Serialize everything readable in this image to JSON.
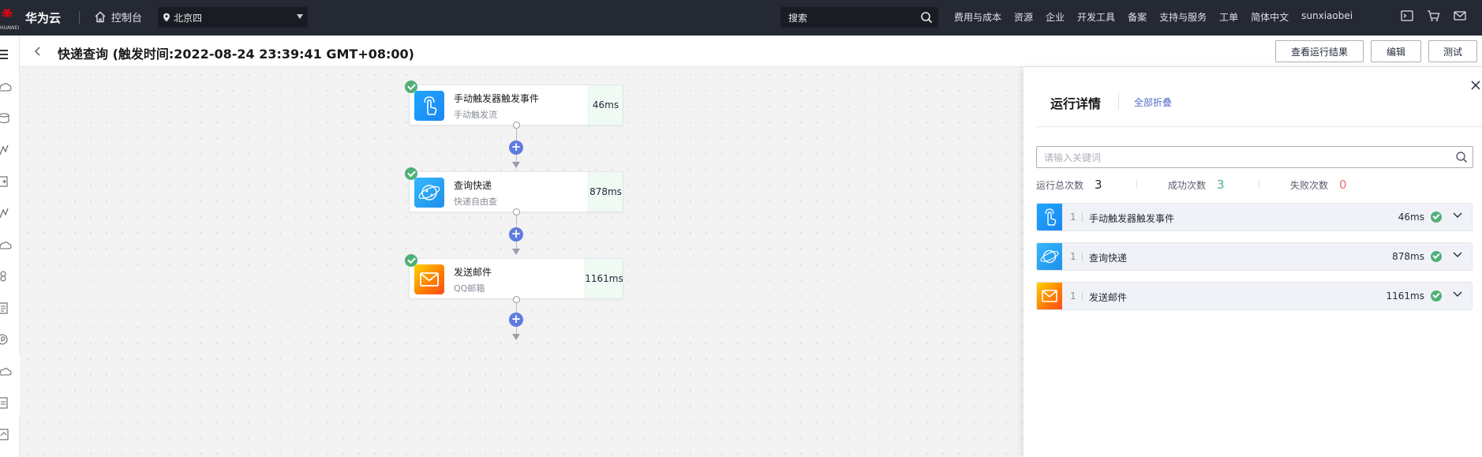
{
  "topnav": {
    "logo_text": "HUAWEI",
    "brand": "华为云",
    "console_label": "控制台",
    "region": "北京四",
    "search_placeholder": "搜索",
    "links": [
      "费用与成本",
      "资源",
      "企业",
      "开发工具",
      "备案",
      "支持与服务",
      "工单",
      "简体中文",
      "sunxiaobei"
    ],
    "icons": [
      "terminal-icon",
      "cart-icon",
      "mail-icon"
    ]
  },
  "subheader": {
    "title": "快递查询 (触发时间:2022-08-24 23:39:41 GMT+08:00)",
    "buttons": {
      "view_results": "查看运行结果",
      "edit": "编辑",
      "test": "测试"
    }
  },
  "flow": {
    "nodes": [
      {
        "title": "手动触发器触发事件",
        "subtitle": "手动触发流",
        "time": "46ms",
        "icon": "touch-icon"
      },
      {
        "title": "查询快递",
        "subtitle": "快递自由查",
        "time": "878ms",
        "icon": "planet-icon"
      },
      {
        "title": "发送邮件",
        "subtitle": "QQ邮箱",
        "time": "1161ms",
        "icon": "mail-icon"
      }
    ]
  },
  "panel": {
    "title": "运行详情",
    "collapse_all": "全部折叠",
    "keyword_placeholder": "请输入关键词",
    "stats": {
      "total_label": "运行总次数",
      "total_value": "3",
      "success_label": "成功次数",
      "success_value": "3",
      "fail_label": "失败次数",
      "fail_value": "0"
    },
    "rows": [
      {
        "index": "1",
        "name": "手动触发器触发事件",
        "time": "46ms"
      },
      {
        "index": "1",
        "name": "查询快递",
        "time": "878ms"
      },
      {
        "index": "1",
        "name": "发送邮件",
        "time": "1161ms"
      }
    ]
  },
  "colors": {
    "success": "#50b078",
    "fail": "#f66f6a",
    "link": "#526ecc",
    "add": "#5e7ce0"
  }
}
